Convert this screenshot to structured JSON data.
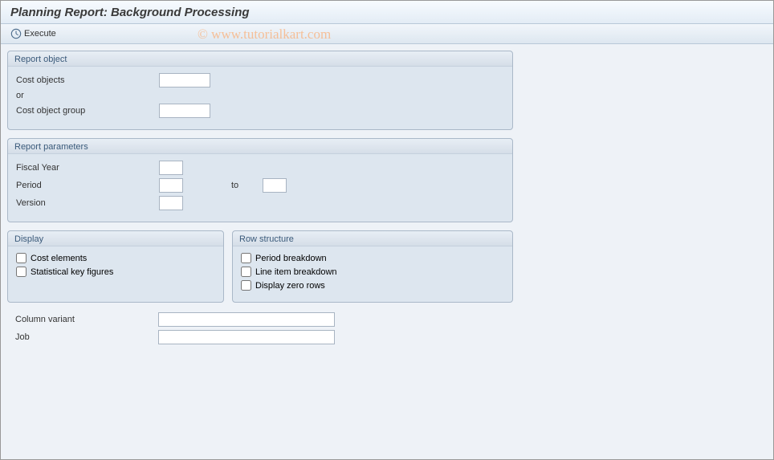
{
  "title": "Planning Report: Background Processing",
  "toolbar": {
    "execute_label": "Execute"
  },
  "watermark": "© www.tutorialkart.com",
  "groups": {
    "report_object": {
      "title": "Report object",
      "cost_objects_label": "Cost objects",
      "cost_objects_value": "",
      "or_label": "or",
      "cost_object_group_label": "Cost object group",
      "cost_object_group_value": ""
    },
    "report_params": {
      "title": "Report parameters",
      "fiscal_year_label": "Fiscal Year",
      "fiscal_year_value": "",
      "period_label": "Period",
      "period_from_value": "",
      "to_label": "to",
      "period_to_value": "",
      "version_label": "Version",
      "version_value": ""
    },
    "display": {
      "title": "Display",
      "cost_elements_label": "Cost elements",
      "statistical_key_label": "Statistical key figures"
    },
    "row_structure": {
      "title": "Row structure",
      "period_breakdown_label": "Period breakdown",
      "line_item_label": "Line item breakdown",
      "zero_rows_label": "Display zero rows"
    }
  },
  "bottom": {
    "column_variant_label": "Column variant",
    "column_variant_value": "",
    "job_label": "Job",
    "job_value": ""
  }
}
